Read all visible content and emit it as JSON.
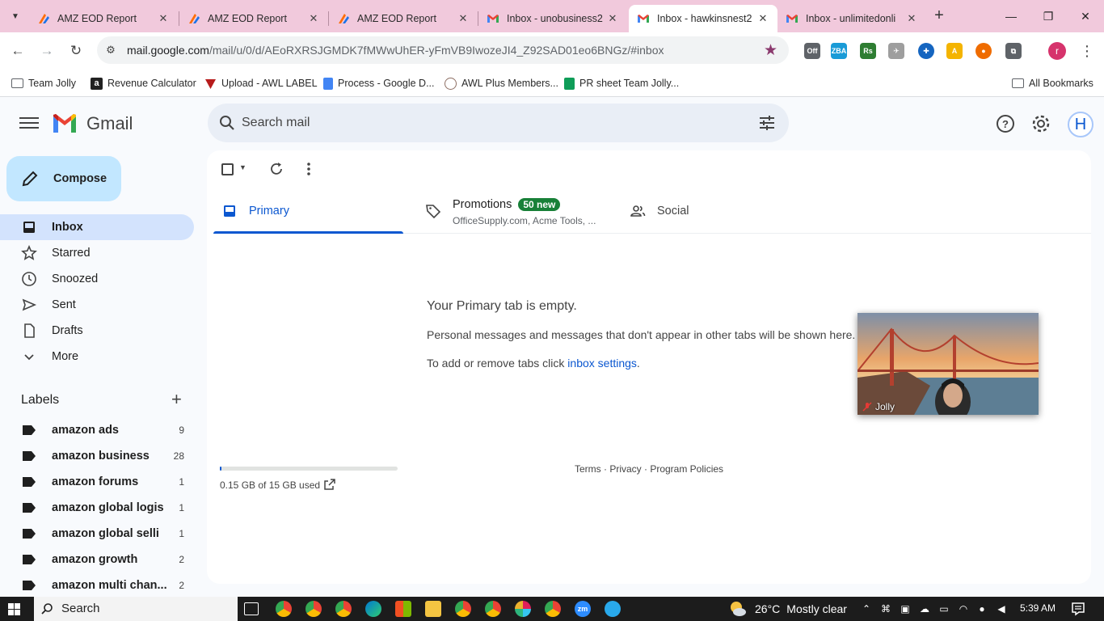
{
  "browser": {
    "tabs": [
      {
        "title": "AMZ EOD Report",
        "favicon": "zapier-orange-icon",
        "active": false
      },
      {
        "title": "AMZ EOD Report",
        "favicon": "zapier-orange-icon",
        "active": false
      },
      {
        "title": "AMZ EOD Report",
        "favicon": "zapier-orange-icon",
        "active": false
      },
      {
        "title": "Inbox - unobusiness2",
        "favicon": "gmail-icon",
        "active": false
      },
      {
        "title": "Inbox - hawkinsnest2",
        "favicon": "gmail-icon",
        "active": true
      },
      {
        "title": "Inbox - unlimitedonli",
        "favicon": "gmail-icon",
        "active": false
      }
    ],
    "close_glyph": "✕",
    "new_tab_glyph": "+",
    "url_host": "mail.google.com",
    "url_path": "/mail/u/0/d/AEoRXRSJGMDK7fMWwUhER-yFmVB9IwozeJI4_Z92SAD01eo6BNGz/#inbox",
    "profile_initial": "r",
    "extensions": [
      {
        "name": "off-extension-icon",
        "text": "Off",
        "color": "#5f6368"
      },
      {
        "name": "zba-extension-icon",
        "text": "ZBA",
        "color": "#1a9bd7"
      },
      {
        "name": "rs-extension-icon",
        "text": "Rs",
        "color": "#2e7d32"
      },
      {
        "name": "plane-extension-icon",
        "text": "✈",
        "color": "#9e9e9e"
      },
      {
        "name": "crosshair-extension-icon",
        "text": "✚",
        "color": "#1565c0"
      },
      {
        "name": "accent-extension-icon",
        "text": "A",
        "color": "#f4b400"
      },
      {
        "name": "orb-extension-icon",
        "text": "●",
        "color": "#ef6c00"
      },
      {
        "name": "puzzle-extension-icon",
        "text": "⧉",
        "color": "#5f6368"
      }
    ],
    "bookmarks": [
      {
        "label": "Team Jolly",
        "icon": "folder-icon",
        "color": "#5f6368"
      },
      {
        "label": "Revenue Calculator",
        "icon": "amazon-icon",
        "color": "#222222"
      },
      {
        "label": "Upload - AWL LABEL",
        "icon": "awl-icon",
        "color": "#b71c1c"
      },
      {
        "label": "Process - Google D...",
        "icon": "google-docs-icon",
        "color": "#4285f4"
      },
      {
        "label": "AWL Plus Members...",
        "icon": "awl-plus-icon",
        "color": "#8d6e63"
      },
      {
        "label": "PR sheet Team Jolly...",
        "icon": "google-sheets-icon",
        "color": "#0f9d58"
      }
    ],
    "all_bookmarks": "All Bookmarks"
  },
  "gmail": {
    "logo_text": "Gmail",
    "search_placeholder": "Search mail",
    "avatar_initial": "H",
    "compose_label": "Compose",
    "nav": [
      {
        "label": "Inbox",
        "icon": "inbox-icon",
        "active": true
      },
      {
        "label": "Starred",
        "icon": "star-icon",
        "active": false
      },
      {
        "label": "Snoozed",
        "icon": "clock-icon",
        "active": false
      },
      {
        "label": "Sent",
        "icon": "send-icon",
        "active": false
      },
      {
        "label": "Drafts",
        "icon": "draft-icon",
        "active": false
      },
      {
        "label": "More",
        "icon": "chevron-down-icon",
        "active": false
      }
    ],
    "labels_title": "Labels",
    "labels": [
      {
        "name": "amazon ads",
        "count": "9"
      },
      {
        "name": "amazon business",
        "count": "28"
      },
      {
        "name": "amazon forums",
        "count": "1"
      },
      {
        "name": "amazon global logis",
        "count": "1"
      },
      {
        "name": "amazon global selli",
        "count": "1"
      },
      {
        "name": "amazon growth",
        "count": "2"
      },
      {
        "name": "amazon multi chan...",
        "count": "2"
      }
    ],
    "tabs": {
      "primary": "Primary",
      "promotions": "Promotions",
      "promotions_badge": "50 new",
      "promotions_senders": "OfficeSupply.com, Acme Tools, ...",
      "social": "Social"
    },
    "empty_title": "Your Primary tab is empty.",
    "empty_line1": "Personal messages and messages that don't appear in other tabs will be shown here.",
    "empty_line2_prefix": "To add or remove tabs click ",
    "empty_line2_link": "inbox settings",
    "empty_line2_suffix": ".",
    "storage_text": "0.15 GB of 15 GB used",
    "storage_fraction": 0.01,
    "footer": "Terms · Privacy · Program Policies"
  },
  "video_call": {
    "participant": "Jolly"
  },
  "taskbar": {
    "search_label": "Search",
    "weather_temp": "26°C",
    "weather_desc": "Mostly clear",
    "time": "5:39 AM"
  },
  "colors": {
    "tabstrip": "#f1c9dc",
    "accent": "#0b57d0",
    "compose": "#c2e7ff",
    "nav_active": "#d3e3fd",
    "promo_badge": "#188038"
  }
}
